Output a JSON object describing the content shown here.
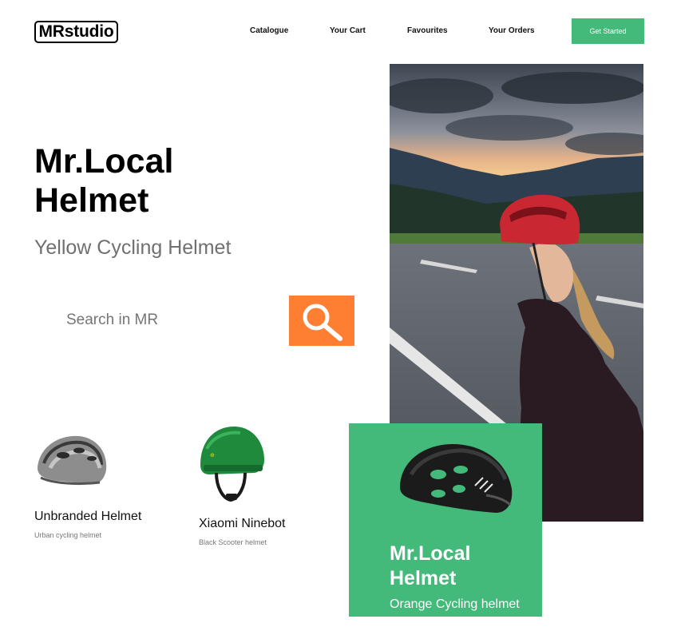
{
  "brand": {
    "logo_text": "MRstudio"
  },
  "nav": {
    "items": [
      "Catalogue",
      "Your Cart",
      "Favourites",
      "Your Orders"
    ],
    "cta_label": "Get Started"
  },
  "hero": {
    "title": "Mr.Local Helmet",
    "subtitle": "Yellow Cycling Helmet",
    "search_placeholder": "Search in MR"
  },
  "products": [
    {
      "name": "Unbranded Helmet",
      "description": "Urban cycling helmet"
    },
    {
      "name": "Xiaomi Ninebot",
      "description": "Black Scooter helmet"
    }
  ],
  "featured": {
    "title": "Mr.Local Helmet",
    "subtitle": "Orange Cycling helmet"
  },
  "colors": {
    "accent_green": "#43b97a",
    "search_orange": "#ff7f32"
  }
}
